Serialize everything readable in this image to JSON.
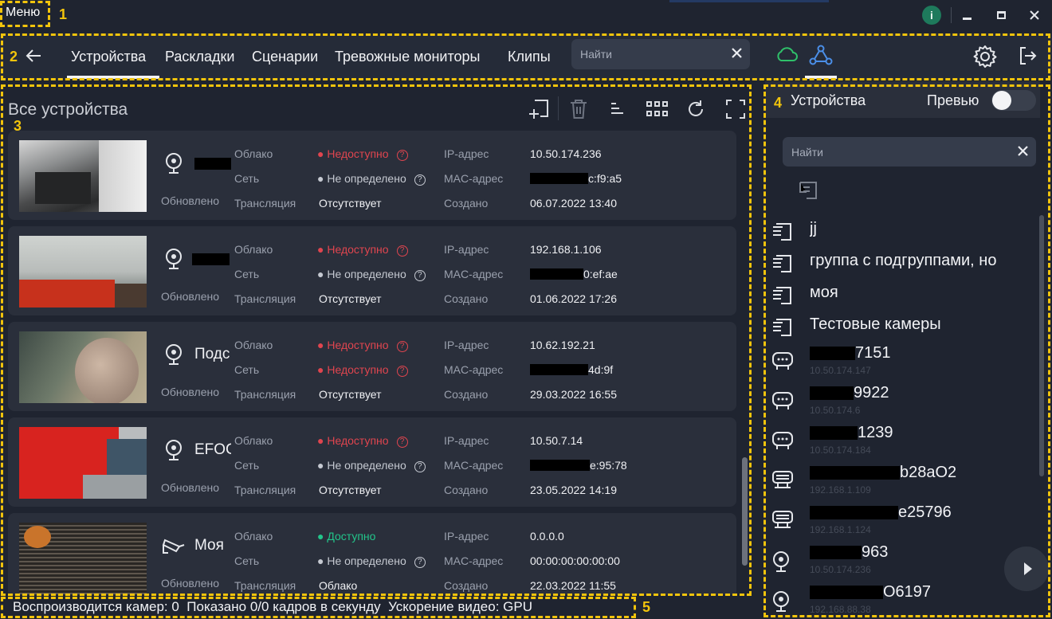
{
  "window": {
    "menu": "Меню"
  },
  "nav": {
    "tabs": [
      "Устройства",
      "Раскладки",
      "Сценарии",
      "Тревожные мониторы",
      "Клипы"
    ],
    "search_placeholder": "Найти"
  },
  "devices": {
    "title": "Все устройства",
    "labels": {
      "cloud": "Облако",
      "network": "Сеть",
      "stream": "Трансляция",
      "updated": "Обновлено",
      "ip": "IP-адрес",
      "mac": "MAC-адрес",
      "created": "Создано"
    },
    "items": [
      {
        "name": "",
        "cloud": "Недоступно",
        "network": "Не определено",
        "stream": "Отсутствует",
        "ip": "10.50.174.236",
        "mac_tail": "c:f9:a5",
        "created": "06.07.2022 13:40"
      },
      {
        "name": "",
        "cloud": "Недоступно",
        "network": "Не определено",
        "stream": "Отсутствует",
        "ip": "192.168.1.106",
        "mac_tail": "0:ef:ae",
        "created": "01.06.2022 17:26"
      },
      {
        "name": "Подс",
        "cloud": "Недоступно",
        "network": "Недоступно",
        "stream": "Отсутствует",
        "ip": "10.62.192.21",
        "mac_tail": "4d:9f",
        "created": "29.03.2022 16:55"
      },
      {
        "name": "EFOC",
        "cloud": "Недоступно",
        "network": "Не определено",
        "stream": "Отсутствует",
        "ip": "10.50.7.14",
        "mac_tail": "e:95:78",
        "created": "23.05.2022 14:19"
      },
      {
        "name": "Моя",
        "cloud": "Доступно",
        "network": "Не определено",
        "stream": "Облако",
        "ip": "0.0.0.0",
        "mac_tail": "00:00:00:00:00:00",
        "created": "22.03.2022 11:55"
      }
    ]
  },
  "side": {
    "title": "Устройства",
    "preview": "Превью",
    "search_placeholder": "Найти",
    "groups": [
      "jj",
      "группа с подгруппами, но",
      "моя",
      "Тестовые камеры"
    ],
    "devices": [
      {
        "name_tail": "7151",
        "ip": "10.50.174.147"
      },
      {
        "name_tail": "9922",
        "ip": "10.50.174.6"
      },
      {
        "name_tail": "1239",
        "ip": "10.50.174.184"
      },
      {
        "name_tail": "b28aO2",
        "ip": "192.168.1.109"
      },
      {
        "name_tail": "e25796",
        "ip": "192.168.1.124"
      },
      {
        "name_tail": "963",
        "ip": "10.50.174.236"
      },
      {
        "name_tail": "O6197",
        "ip": "192.168.88.38"
      }
    ]
  },
  "status": {
    "text": "Воспроизводится камер: 0  Показано 0/0 кадров в секунду  Ускорение видео: GPU"
  },
  "annotations": [
    "1",
    "2",
    "3",
    "4",
    "5"
  ]
}
